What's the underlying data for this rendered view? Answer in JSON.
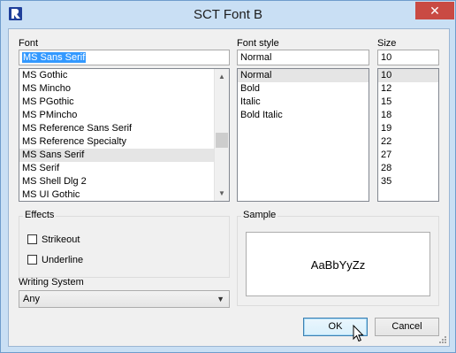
{
  "window": {
    "title": "SCT Font B",
    "close_glyph": "✕",
    "app_icon": "r-logo-icon"
  },
  "font": {
    "label": "Font",
    "value": "MS Sans Serif",
    "items": [
      "MS Gothic",
      "MS Mincho",
      "MS PGothic",
      "MS PMincho",
      "MS Reference Sans Serif",
      "MS Reference Specialty",
      "MS Sans Serif",
      "MS Serif",
      "MS Shell Dlg 2",
      "MS UI Gothic"
    ],
    "selected": "MS Sans Serif"
  },
  "style": {
    "label": "Font style",
    "value": "Normal",
    "items": [
      "Normal",
      "Bold",
      "Italic",
      "Bold Italic"
    ],
    "selected": "Normal"
  },
  "size": {
    "label": "Size",
    "value": "10",
    "items": [
      "10",
      "12",
      "15",
      "18",
      "19",
      "22",
      "27",
      "28",
      "35"
    ],
    "selected": "10"
  },
  "effects": {
    "label": "Effects",
    "strikeout_label": "Strikeout",
    "strikeout_checked": false,
    "underline_label": "Underline",
    "underline_checked": false
  },
  "sample": {
    "label": "Sample",
    "text": "AaBbYyZz"
  },
  "writing_system": {
    "label": "Writing System",
    "value": "Any"
  },
  "buttons": {
    "ok": "OK",
    "cancel": "Cancel"
  },
  "colors": {
    "titlebar": "#c9dff4",
    "close": "#c94a43",
    "selection": "#3399ff"
  }
}
